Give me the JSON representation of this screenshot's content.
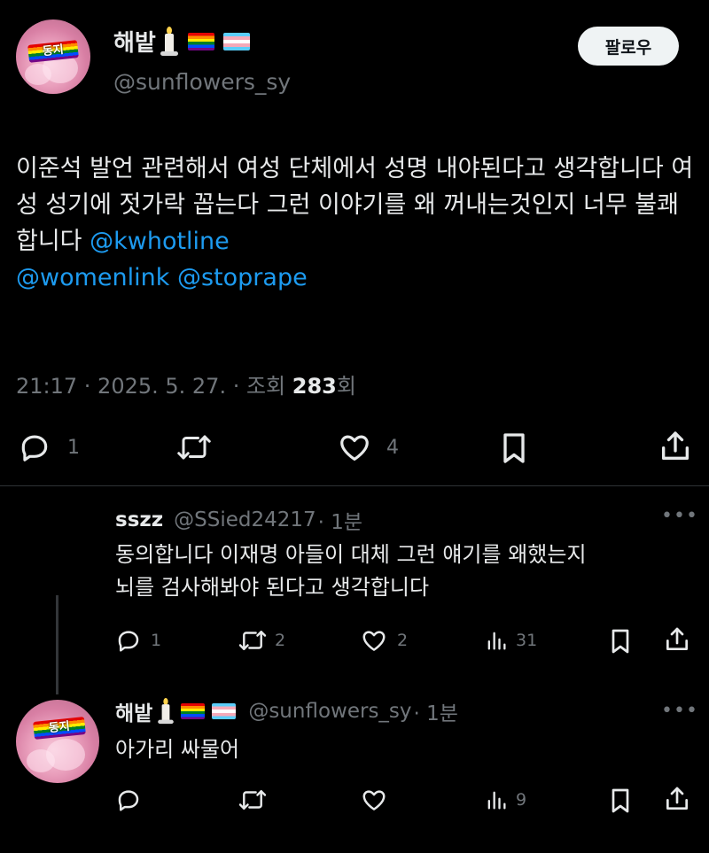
{
  "post": {
    "author_name": "해밭",
    "author_handle": "@sunflowers_sy",
    "avatar_label": "동지",
    "follow_label": "팔로우",
    "text": "이준석 발언 관련해서 여성 단체에서 성명 내야된다고 생각합니다 여성 성기에 젓가락 꼽는다 그런 이야기를 왜 꺼내는것인지 너무 불쾌합니다 ",
    "mentions": [
      "@kwhotline",
      "@womenlink",
      "@stoprape"
    ],
    "meta_time": "21:17 · 2025. 5. 27. · 조회 ",
    "meta_views": "283",
    "meta_views_unit": "회",
    "reply_count": "1",
    "like_count": "4"
  },
  "reply1": {
    "author_name": "sszz",
    "author_handle": "@SSied24217",
    "time": "· 1분",
    "text_line1": "동의합니다 이재명 아들이 대체 그런 얘기를 왜했는지",
    "text_line2": "뇌를 검사해봐야 된다고 생각합니다",
    "reply_count": "1",
    "repost_count": "2",
    "like_count": "2",
    "view_count": "31"
  },
  "reply2": {
    "author_name": "해밭",
    "author_handle": "@sunflowers_sy",
    "time": "· 1분",
    "avatar_label": "동지",
    "text": "아가리 싸물어",
    "view_count": "9"
  },
  "icons": {
    "reply": "reply-icon",
    "repost": "repost-icon",
    "like": "heart-icon",
    "bookmark": "bookmark-icon",
    "share": "share-icon",
    "views": "views-icon",
    "more": "more-icon"
  },
  "colors": {
    "background": "#000000",
    "text": "#e7e9ea",
    "muted": "#71767b",
    "link": "#1d9bf0",
    "follow_bg": "#eff3f4"
  }
}
